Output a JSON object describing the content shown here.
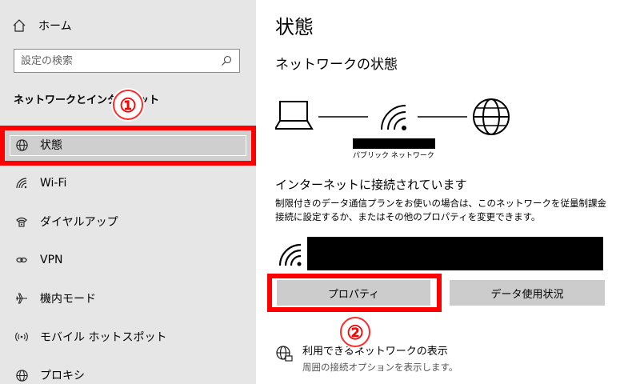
{
  "sidebar": {
    "home_label": "ホーム",
    "search_placeholder": "設定の検索",
    "section_title": "ネットワークとインターネット",
    "items": [
      {
        "label": "状態",
        "icon": "globe-icon"
      },
      {
        "label": "Wi-Fi",
        "icon": "wifi-icon"
      },
      {
        "label": "ダイヤルアップ",
        "icon": "phone-icon"
      },
      {
        "label": "VPN",
        "icon": "vpn-icon"
      },
      {
        "label": "機内モード",
        "icon": "airplane-icon"
      },
      {
        "label": "モバイル ホットスポット",
        "icon": "hotspot-icon"
      },
      {
        "label": "プロキシ",
        "icon": "globe-icon"
      }
    ]
  },
  "main": {
    "page_title": "状態",
    "section_title": "ネットワークの状態",
    "network_label": "パブリック ネットワーク",
    "connection_title": "インターネットに接続されています",
    "connection_desc": "制限付きのデータ通信プランをお使いの場合は、このネットワークを従量制課金接続に設定するか、またはその他のプロパティを変更できます。",
    "properties_button": "プロパティ",
    "data_usage_button": "データ使用状況",
    "available_title": "利用できるネットワークの表示",
    "available_desc": "周囲の接続オプションを表示します。"
  },
  "annotations": {
    "badge1": "①",
    "badge2": "②"
  },
  "colors": {
    "highlight": "#ff0000",
    "sidebar_bg": "#e6e6e6",
    "button_bg": "#cccccc"
  }
}
